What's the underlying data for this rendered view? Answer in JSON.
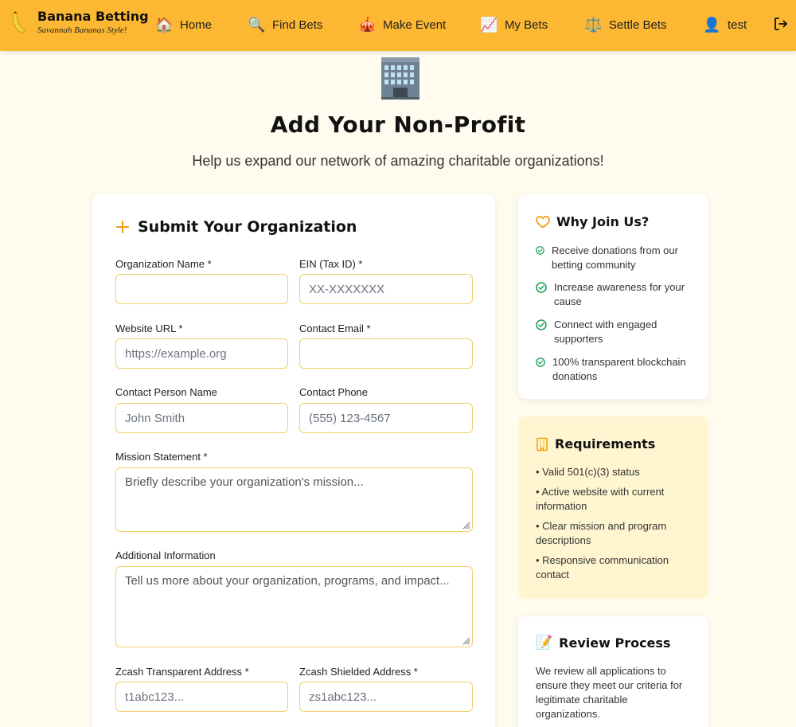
{
  "nav": {
    "brand_title": "Banana Betting",
    "brand_subtitle": "Savannah Bananas Style!",
    "brand_icon": "banana-icon",
    "items": [
      {
        "label": "Home",
        "icon": "🏠"
      },
      {
        "label": "Find Bets",
        "icon": "🔍"
      },
      {
        "label": "Make Event",
        "icon": "🎪"
      },
      {
        "label": "My Bets",
        "icon": "📈"
      },
      {
        "label": "Settle Bets",
        "icon": "⚖️"
      },
      {
        "label": "test",
        "icon": "👤"
      }
    ],
    "logout_icon": "logout-icon"
  },
  "header": {
    "icon": "office-building-icon",
    "title": "Add Your Non-Profit",
    "subtitle": "Help us expand our network of amazing charitable organizations!"
  },
  "form": {
    "title": "Submit Your Organization",
    "org_name": {
      "label": "Organization Name *",
      "value": ""
    },
    "ein": {
      "label": "EIN (Tax ID) *",
      "placeholder": "XX-XXXXXXX"
    },
    "website": {
      "label": "Website URL *",
      "placeholder": "https://example.org"
    },
    "email": {
      "label": "Contact Email *",
      "value": ""
    },
    "contact_person": {
      "label": "Contact Person Name",
      "placeholder": "John Smith"
    },
    "phone": {
      "label": "Contact Phone",
      "placeholder": "(555) 123-4567"
    },
    "mission": {
      "label": "Mission Statement *",
      "placeholder": "Briefly describe your organization's mission..."
    },
    "additional": {
      "label": "Additional Information",
      "placeholder": "Tell us more about your organization, programs, and impact..."
    },
    "zcash_t": {
      "label": "Zcash Transparent Address *",
      "placeholder": "t1abc123..."
    },
    "zcash_z": {
      "label": "Zcash Shielded Address *",
      "placeholder": "zs1abc123..."
    }
  },
  "why": {
    "title": "Why Join Us?",
    "items": [
      "Receive donations from our betting community",
      "Increase awareness for your cause",
      "Connect with engaged supporters",
      "100% transparent blockchain donations"
    ]
  },
  "requirements": {
    "title": "Requirements",
    "items": [
      "• Valid 501(c)(3) status",
      "• Active website with current information",
      "• Clear mission and program descriptions",
      "• Responsive communication contact"
    ]
  },
  "review": {
    "title": "Review Process",
    "icon": "📝",
    "body": "We review all applications to ensure they meet our criteria for legitimate charitable organizations."
  },
  "colors": {
    "nav_bg": "#fdb833",
    "page_bg": "#fffcef",
    "accent": "#f59e0b",
    "input_border": "#f3cf6a",
    "check_green": "#22a35a",
    "req_bg": "#fff6d1"
  }
}
